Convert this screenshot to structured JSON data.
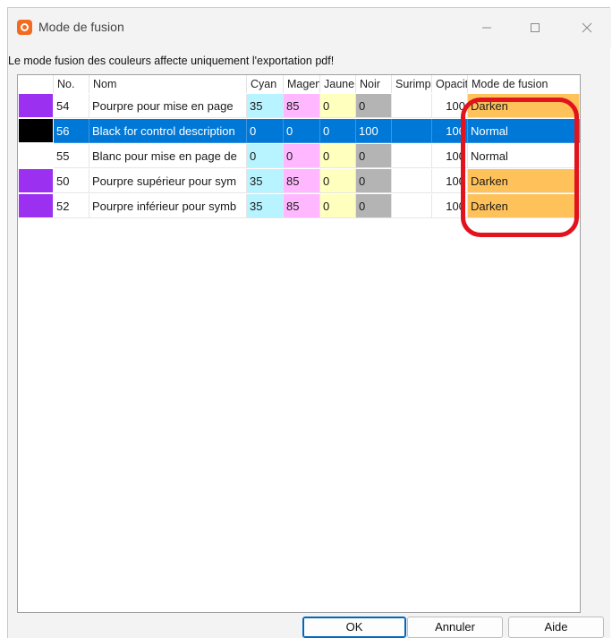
{
  "window": {
    "title": "Mode de fusion"
  },
  "info_text": "Le mode fusion des couleurs affecte uniquement l'exportation pdf!",
  "table": {
    "columns": [
      "No.",
      "Nom",
      "Cyan",
      "Magenta",
      "Jaune",
      "Noir",
      "Surimpression",
      "Opacité",
      "Mode de fusion"
    ],
    "rows": [
      {
        "swatch": "#9b30f0",
        "no": "54",
        "nom": "Pourpre pour mise en page",
        "cyan": "35",
        "magenta": "85",
        "jaune": "0",
        "noir": "0",
        "surimp": "",
        "opacite": "100",
        "mode": "Darken",
        "selected": false
      },
      {
        "swatch": "#000000",
        "no": "56",
        "nom": "Black for control description",
        "cyan": "0",
        "magenta": "0",
        "jaune": "0",
        "noir": "100",
        "surimp": "",
        "opacite": "100",
        "mode": "Normal",
        "selected": true
      },
      {
        "swatch": "#ffffff",
        "no": "55",
        "nom": "Blanc pour mise en page de",
        "cyan": "0",
        "magenta": "0",
        "jaune": "0",
        "noir": "0",
        "surimp": "",
        "opacite": "100",
        "mode": "Normal",
        "selected": false
      },
      {
        "swatch": "#9b30f0",
        "no": "50",
        "nom": "Pourpre supérieur pour sym",
        "cyan": "35",
        "magenta": "85",
        "jaune": "0",
        "noir": "0",
        "surimp": "",
        "opacite": "100",
        "mode": "Darken",
        "selected": false
      },
      {
        "swatch": "#9b30f0",
        "no": "52",
        "nom": "Pourpre inférieur pour symb",
        "cyan": "35",
        "magenta": "85",
        "jaune": "0",
        "noir": "0",
        "surimp": "",
        "opacite": "100",
        "mode": "Darken",
        "selected": false
      }
    ]
  },
  "buttons": {
    "ok": "OK",
    "cancel": "Annuler",
    "help": "Aide"
  },
  "colors": {
    "cyan_bg": "#b8f4ff",
    "magenta_bg": "#ffb8ff",
    "jaune_bg": "#ffffbe",
    "noir_bg": "#b4b4b4",
    "darken_bg": "#ffc25a",
    "selection": "#0078d7",
    "highlight": "#e2131d"
  }
}
